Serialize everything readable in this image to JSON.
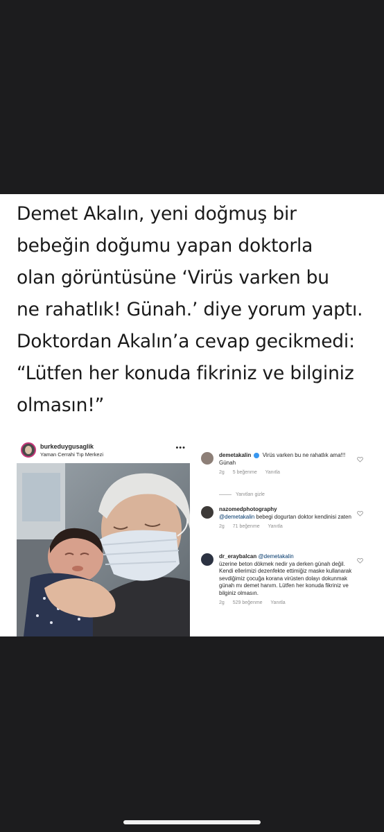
{
  "tweet": {
    "text": "Demet Akalın, yeni doğmuş bir\nbebeğin doğumu yapan doktorla\nolan görüntüsüne ‘Virüs varken bu\nne rahatlık! Günah.’ diye yorum yaptı.\nDoktordan Akalın’a cevap gecikmedi:\n“Lütfen her konuda fikriniz ve bilginiz\nolmasın!”"
  },
  "instagram_post": {
    "username": "burkeduygusaglik",
    "location": "Yaman Cerrahi Tıp Merkezi",
    "more_icon": "more-horizontal-icon"
  },
  "comments": [
    {
      "username": "demetakalin",
      "verified": true,
      "text": "Virüs varken bu ne rahatlık ama!!! Günah",
      "time": "2g",
      "likes": "5 beğenme",
      "reply": "Yanıtla"
    },
    {
      "username": "nazomedphotography",
      "mention": "@demetakalin",
      "text": "bebegi dogurtan doktor kendinisi zaten",
      "time": "2g",
      "likes": "71 beğenme",
      "reply": "Yanıtla"
    },
    {
      "username": "dr_eraybalcan",
      "mention": "@demetakalin",
      "text": "üzerine beton dökmek nedir ya derken günah değil. Kendi ellerimizi dezenfekte ettimiğiz maske kullanarak sevdiğimiz çocuğa korana virüsten dolayı dokunmak günah mı demet hanım. Lütfen her konuda fikriniz ve bilginiz olmasın.",
      "time": "2g",
      "likes": "529 beğenme",
      "reply": "Yanıtla"
    }
  ],
  "hide_replies": "Yanıtları gizle",
  "colors": {
    "background_dark": "#1c1c1e",
    "card": "#ffffff",
    "instagram_ring": "#c7367a",
    "mention": "#00376b",
    "verified": "#3897f0"
  }
}
